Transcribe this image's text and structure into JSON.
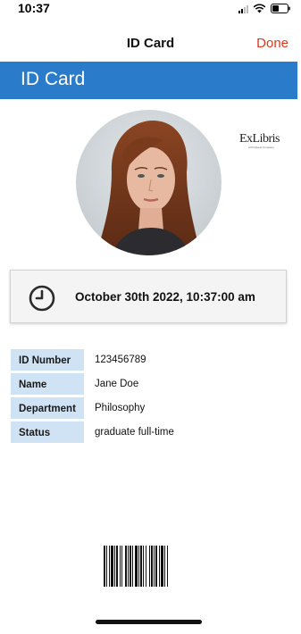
{
  "status_bar": {
    "time": "10:37",
    "icons": [
      "cellular-signal-icon",
      "wifi-icon",
      "battery-icon"
    ]
  },
  "nav": {
    "title": "ID Card",
    "done_label": "Done"
  },
  "header": {
    "title": "ID Card"
  },
  "logo": {
    "text": "ExLibris",
    "subtext": "a ProQuest Company"
  },
  "timestamp": {
    "icon": "clock-icon",
    "text": "October 30th 2022, 10:37:00 am"
  },
  "info": [
    {
      "label": "ID Number",
      "value": "123456789"
    },
    {
      "label": "Name",
      "value": "Jane Doe"
    },
    {
      "label": "Department",
      "value": "Philosophy"
    },
    {
      "label": "Status",
      "value": "graduate full-time"
    }
  ],
  "colors": {
    "header_band": "#2a7ccb",
    "done_accent": "#d9391c",
    "label_background": "#cfe3f5"
  }
}
